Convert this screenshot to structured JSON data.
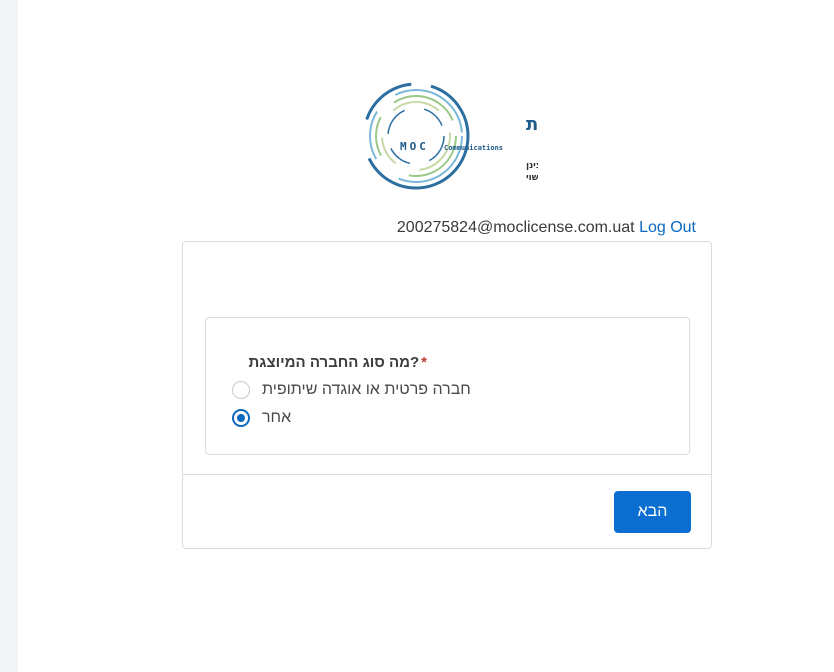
{
  "logo": {
    "hebrew_title": "משרד התקשורת",
    "latin_abbr": "MOC",
    "latin_sub": "Communications",
    "line1": "אור צינן",
    "line2": "אסדרה ורישוי"
  },
  "user": {
    "email": "200275824@moclicense.com.uat",
    "logout_label": "Log Out"
  },
  "form": {
    "question": "?מה סוג החברה המיוצגת",
    "required_mark": "*",
    "options": [
      {
        "label": "חברה פרטית או אוגדה שיתופית",
        "selected": false
      },
      {
        "label": "אחר",
        "selected": true
      }
    ],
    "next_label": "הבא"
  },
  "colors": {
    "accent": "#0b6fd1",
    "link": "#0b69c2",
    "required": "#c23934"
  }
}
